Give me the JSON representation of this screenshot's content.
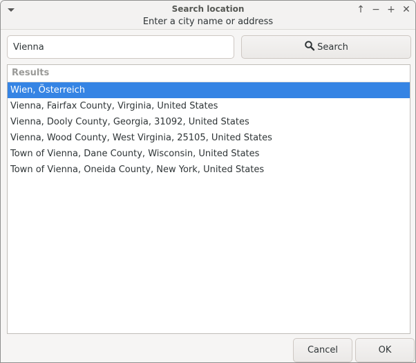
{
  "window": {
    "title": "Search location",
    "subtitle": "Enter a city name or address",
    "controls": {
      "menu": "window-menu",
      "raise_glyph": "↑",
      "minimize_glyph": "−",
      "maximize_glyph": "+",
      "close_glyph": "✕"
    }
  },
  "search": {
    "value": "Vienna",
    "button_label": "Search",
    "button_icon": "magnifier-icon"
  },
  "results": {
    "header": "Results",
    "selected_index": 0,
    "items": [
      {
        "label": "Wien, Österreich"
      },
      {
        "label": "Vienna, Fairfax County, Virginia, United States"
      },
      {
        "label": "Vienna, Dooly County, Georgia, 31092, United States"
      },
      {
        "label": "Vienna, Wood County, West Virginia, 25105, United States"
      },
      {
        "label": "Town of Vienna, Dane County, Wisconsin, United States"
      },
      {
        "label": "Town of Vienna, Oneida County, New York, United States"
      }
    ]
  },
  "buttons": {
    "cancel_label": "Cancel",
    "ok_label": "OK"
  },
  "colors": {
    "selection": "#3584e4",
    "window_bg": "#f6f5f4"
  }
}
